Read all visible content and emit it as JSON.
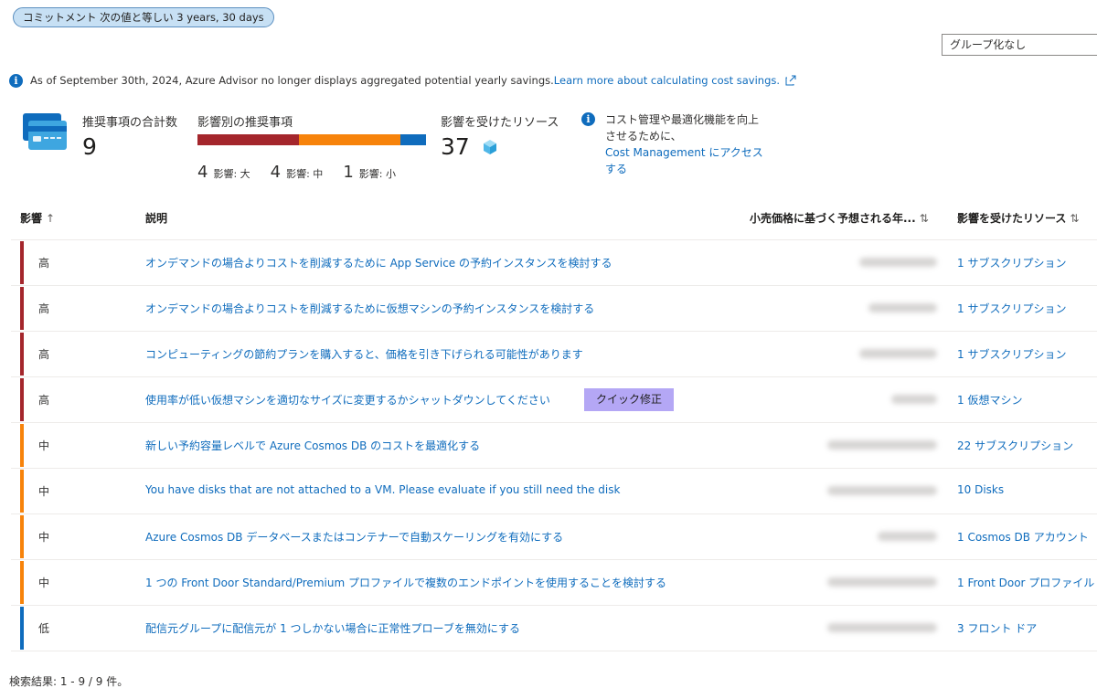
{
  "filter_pill": "コミットメント 次の値と等しい 3 years, 30 days",
  "group_by": "グループ化なし",
  "banner": {
    "text": "As of September 30th, 2024, Azure Advisor no longer displays aggregated potential yearly savings.",
    "link": "Learn more about calculating cost savings."
  },
  "summary": {
    "total_label": "推奨事項の合計数",
    "total_value": "9",
    "by_impact_label": "影響別の推奨事項",
    "high_count": "4",
    "high_label": "影響: 大",
    "medium_count": "4",
    "medium_label": "影響: 中",
    "low_count": "1",
    "low_label": "影響: 小",
    "impact_shares": {
      "high": 4,
      "medium": 4,
      "low": 1
    },
    "resources_label": "影響を受けたリソース",
    "resources_value": "37",
    "cost_note_text": "コスト管理や最適化機能を向上させるために、",
    "cost_note_link": "Cost Management にアクセスする"
  },
  "table": {
    "headers": {
      "impact": "影響",
      "impact_sort": "↑",
      "description": "説明",
      "savings": "小売価格に基づく予想される年...",
      "savings_sort": "⇅",
      "resources": "影響を受けたリソース",
      "resources_sort": "⇅"
    },
    "rows": [
      {
        "impact": "高",
        "color": "#a4262c",
        "description": "オンデマンドの場合よりコストを削減するために App Service の予約インスタンスを検討する",
        "resources": "1 サブスクリプション"
      },
      {
        "impact": "高",
        "color": "#a4262c",
        "description": "オンデマンドの場合よりコストを削減するために仮想マシンの予約インスタンスを検討する",
        "resources": "1 サブスクリプション"
      },
      {
        "impact": "高",
        "color": "#a4262c",
        "description": "コンピューティングの節約プランを購入すると、価格を引き下げられる可能性があります",
        "resources": "1 サブスクリプション"
      },
      {
        "impact": "高",
        "color": "#a4262c",
        "description": "使用率が低い仮想マシンを適切なサイズに変更するかシャットダウンしてください",
        "quick_fix": "クイック修正",
        "resources": "1 仮想マシン"
      },
      {
        "impact": "中",
        "color": "#f7830b",
        "description": "新しい予約容量レベルで Azure Cosmos DB のコストを最適化する",
        "resources": "22 サブスクリプション"
      },
      {
        "impact": "中",
        "color": "#f7830b",
        "description": "You have disks that are not attached to a VM. Please evaluate if you still need the disk",
        "resources": "10 Disks"
      },
      {
        "impact": "中",
        "color": "#f7830b",
        "description": "Azure Cosmos DB データベースまたはコンテナーで自動スケーリングを有効にする",
        "resources": "1 Cosmos DB アカウント"
      },
      {
        "impact": "中",
        "color": "#f7830b",
        "description": "1 つの Front Door Standard/Premium プロファイルで複数のエンドポイントを使用することを検討する",
        "resources": "1 Front Door プロファイル"
      },
      {
        "impact": "低",
        "color": "#0f6cbd",
        "description": "配信元グループに配信元が 1 つしかない場合に正常性プローブを無効にする",
        "resources": "3 フロント ドア"
      }
    ]
  },
  "footer": "検索結果: 1 - 9 / 9 件。",
  "colors": {
    "high": "#a4262c",
    "medium": "#f7830b",
    "low": "#0f6cbd",
    "link": "#0f6cbd",
    "quick_fix": "#b4a7f5"
  }
}
